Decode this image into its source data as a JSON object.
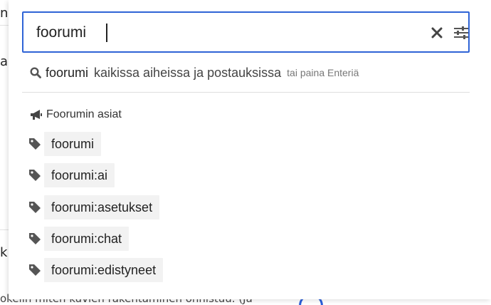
{
  "background": {
    "top_left_text": "ne",
    "mid_left_text": "a",
    "lower_left_text": "k",
    "bottom_text": "okelin miten kuvien rakentaminen onnistuu. (Ja"
  },
  "search": {
    "value": "foorumi",
    "clear_icon": "close-icon",
    "filter_icon": "sliders-icon"
  },
  "suggestion": {
    "icon": "search-icon",
    "term": "foorumi",
    "rest": "kaikissa aiheissa ja postauksissa",
    "hint": "tai paina Enteriä"
  },
  "group": {
    "icon": "megaphone-icon",
    "heading": "Foorumin asiat"
  },
  "tags": [
    {
      "icon": "tag-icon",
      "label": "foorumi"
    },
    {
      "icon": "tag-icon",
      "label": "foorumi:ai"
    },
    {
      "icon": "tag-icon",
      "label": "foorumi:asetukset"
    },
    {
      "icon": "tag-icon",
      "label": "foorumi:chat"
    },
    {
      "icon": "tag-icon",
      "label": "foorumi:edistyneet"
    }
  ],
  "colors": {
    "focus_border": "#2f64d6",
    "chip_bg": "#f2f2f2"
  }
}
